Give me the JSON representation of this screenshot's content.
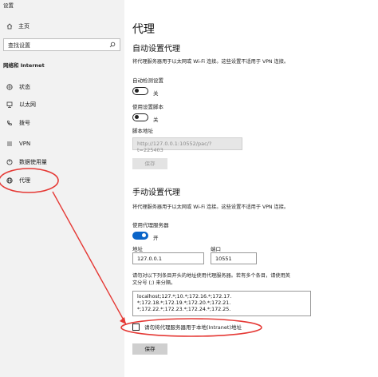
{
  "window": {
    "title": "设置"
  },
  "sidebar": {
    "home_label": "主页",
    "search_placeholder": "查找设置",
    "section_title": "网络和 Internet",
    "items": [
      {
        "label": "状态",
        "icon": "globe-status-icon"
      },
      {
        "label": "以太网",
        "icon": "ethernet-icon"
      },
      {
        "label": "拨号",
        "icon": "phone-icon"
      },
      {
        "label": "VPN",
        "icon": "vpn-icon"
      },
      {
        "label": "数据使用量",
        "icon": "data-usage-icon"
      },
      {
        "label": "代理",
        "icon": "globe-icon"
      }
    ]
  },
  "main": {
    "title": "代理",
    "auto": {
      "heading": "自动设置代理",
      "description": "将代理服务器用于以太网或 Wi-Fi 连接。这些设置不适用于 VPN 连接。",
      "detect_label": "自动检测设置",
      "detect_state": "关",
      "script_label": "使用设置脚本",
      "script_state": "关",
      "script_address_label": "脚本地址",
      "script_address_value": "http://127.0.0.1:10552/pac/?t=225403",
      "save_label": "保存"
    },
    "manual": {
      "heading": "手动设置代理",
      "description": "将代理服务器用于以太网或 Wi-Fi 连接。这些设置不适用于 VPN 连接。",
      "use_proxy_label": "使用代理服务器",
      "use_proxy_state": "开",
      "address_label": "地址",
      "address_value": "127.0.0.1",
      "port_label": "端口",
      "port_value": "10551",
      "exceptions_label_1": "请勿对以下列条目开头的地址使用代理服务器。若有多个条目，请使用英",
      "exceptions_label_2": "文分号 (;) 来分隔。",
      "exceptions_value": "localhost;127.*;10.*;172.16.*;172.17.\n*;172.18.*;172.19.*;172.20.*;172.21.\n*;172.22.*;172.23.*;172.24.*;172.25.",
      "bypass_local_label": "请勿将代理服务器用于本地(Intranet)地址",
      "save_label": "保存"
    }
  },
  "colors": {
    "accent": "#0a64c8",
    "annotation": "#e53935",
    "sidebar_bg": "#f2f2f2"
  }
}
